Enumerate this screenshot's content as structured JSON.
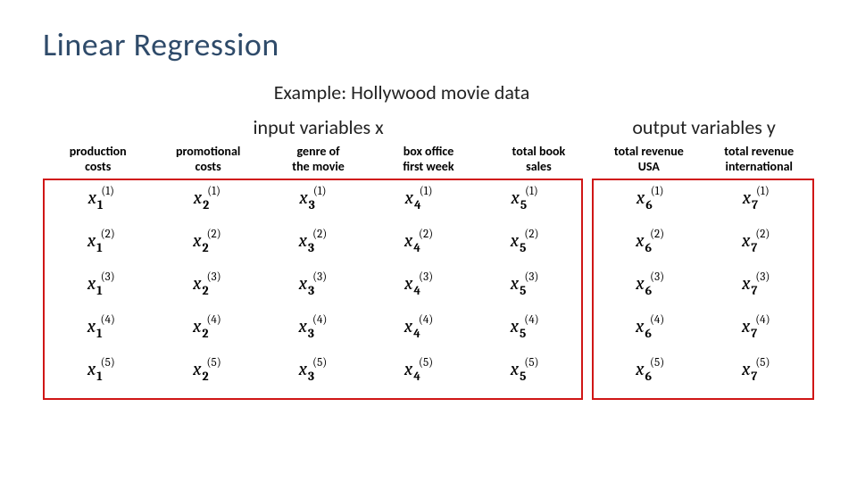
{
  "title": "Linear Regression",
  "subtitle": "Example: Hollywood movie data",
  "sections": {
    "input": "input variables x",
    "output": "output variables y"
  },
  "columns": [
    {
      "header_l1": "production",
      "header_l2": "costs",
      "base": "x",
      "sub": "1"
    },
    {
      "header_l1": "promotional",
      "header_l2": "costs",
      "base": "x",
      "sub": "2"
    },
    {
      "header_l1": "genre of",
      "header_l2": "the movie",
      "base": "x",
      "sub": "3"
    },
    {
      "header_l1": "box office",
      "header_l2": "first week",
      "base": "x",
      "sub": "4"
    },
    {
      "header_l1": "total book",
      "header_l2": "sales",
      "base": "x",
      "sub": "5"
    },
    {
      "header_l1": "total revenue",
      "header_l2": "USA",
      "base": "x",
      "sub": "6"
    },
    {
      "header_l1": "total revenue",
      "header_l2": "international",
      "base": "x",
      "sub": "7"
    }
  ],
  "rows": [
    "(1)",
    "(2)",
    "(3)",
    "(4)",
    "(5)"
  ]
}
